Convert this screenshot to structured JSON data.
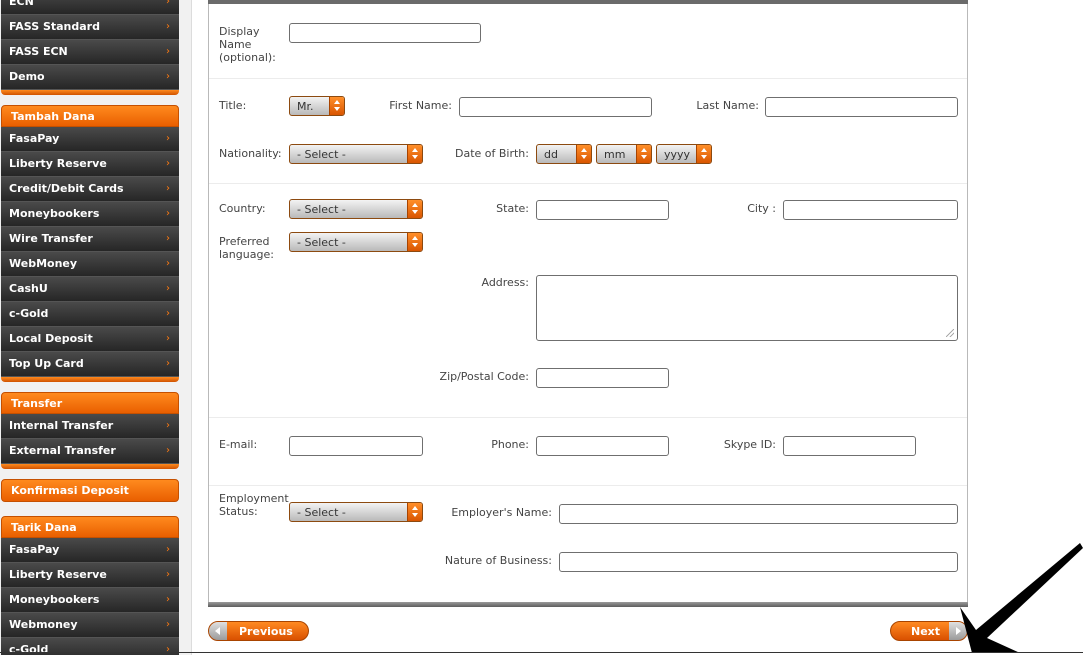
{
  "sidebar": {
    "account_items": [
      "ECN",
      "FASS Standard",
      "FASS ECN",
      "Demo"
    ],
    "tambah_dana": {
      "header": "Tambah Dana",
      "items": [
        "FasaPay",
        "Liberty Reserve",
        "Credit/Debit Cards",
        "Moneybookers",
        "Wire Transfer",
        "WebMoney",
        "CashU",
        "c-Gold",
        "Local Deposit",
        "Top Up Card"
      ]
    },
    "transfer": {
      "header": "Transfer",
      "items": [
        "Internal Transfer",
        "External Transfer"
      ]
    },
    "konfirmasi": {
      "header": "Konfirmasi Deposit"
    },
    "tarik_dana": {
      "header": "Tarik Dana",
      "items": [
        "FasaPay",
        "Liberty Reserve",
        "Moneybookers",
        "Webmoney",
        "c-Gold"
      ]
    },
    "arrow_glyph": "›",
    "colors": {
      "item_bg": "#333333",
      "accent": "#f26b00"
    }
  },
  "form": {
    "display_name": {
      "label": "Display Name (optional):",
      "value": ""
    },
    "title": {
      "label": "Title:",
      "value": "Mr."
    },
    "first_name": {
      "label": "First Name:",
      "value": ""
    },
    "last_name": {
      "label": "Last Name:",
      "value": ""
    },
    "nationality": {
      "label": "Nationality:",
      "value": "- Select -"
    },
    "dob": {
      "label": "Date of Birth:",
      "day": "dd",
      "month": "mm",
      "year": "yyyy"
    },
    "country": {
      "label": "Country:",
      "value": "- Select -"
    },
    "state": {
      "label": "State:",
      "value": ""
    },
    "city": {
      "label": "City :",
      "value": ""
    },
    "language": {
      "label": "Preferred language:",
      "value": "- Select -"
    },
    "address": {
      "label": "Address:",
      "value": ""
    },
    "zip": {
      "label": "Zip/Postal Code:",
      "value": ""
    },
    "email": {
      "label": "E-mail:",
      "value": ""
    },
    "phone": {
      "label": "Phone:",
      "value": ""
    },
    "skype": {
      "label": "Skype ID:",
      "value": ""
    },
    "employment": {
      "label": "Employment Status:",
      "value": "- Select -"
    },
    "employer": {
      "label": "Employer's Name:",
      "value": ""
    },
    "business": {
      "label": "Nature of Business:",
      "value": ""
    }
  },
  "nav": {
    "previous": "Previous",
    "next": "Next"
  },
  "annotation": {
    "icon": "pointing-arrow-icon",
    "color": "#000000"
  }
}
